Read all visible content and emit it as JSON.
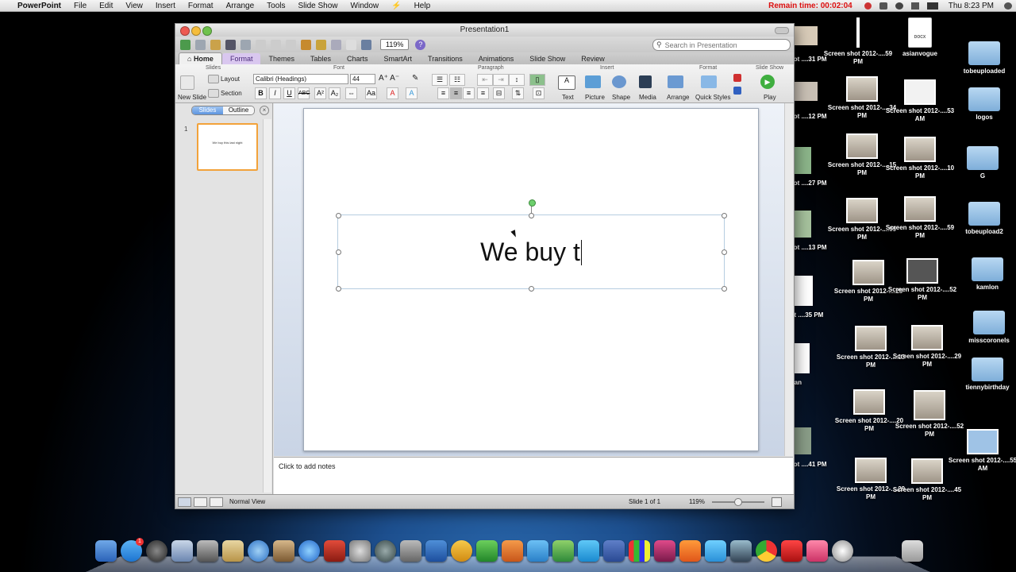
{
  "menubar": {
    "app_name": "PowerPoint",
    "items": [
      "File",
      "Edit",
      "View",
      "Insert",
      "Format",
      "Arrange",
      "Tools",
      "Slide Show",
      "Window",
      "Help"
    ],
    "remain_time": "Remain time: 00:02:04",
    "clock": "Thu 8:23 PM"
  },
  "window": {
    "title": "Presentation1",
    "zoom": "119%",
    "search_placeholder": "Search in Presentation"
  },
  "ribbon_tabs": [
    "Home",
    "Format",
    "Themes",
    "Tables",
    "Charts",
    "SmartArt",
    "Transitions",
    "Animations",
    "Slide Show",
    "Review"
  ],
  "ribbon": {
    "groups": {
      "slides": "Slides",
      "font": "Font",
      "paragraph": "Paragraph",
      "insert": "Insert",
      "format": "Format",
      "slideshow": "Slide Show"
    },
    "new_slide": "New Slide",
    "layout": "Layout",
    "section": "Section",
    "font_name": "Calibri (Headings)",
    "font_size": "44",
    "insert_buttons": [
      "Text",
      "Picture",
      "Shape",
      "Media"
    ],
    "format_buttons": [
      "Arrange",
      "Quick Styles"
    ],
    "play": "Play"
  },
  "left_pane": {
    "tabs": [
      "Slides",
      "Outline"
    ],
    "slide_number": "1",
    "thumb_text": "We buy this last night"
  },
  "slide": {
    "text": "We buy t"
  },
  "notes": {
    "placeholder": "Click to add notes"
  },
  "status": {
    "view": "Normal View",
    "slide": "Slide 1 of 1",
    "zoom": "119%"
  },
  "desktop_icons": {
    "col1": [
      "Screen shot 2012-....59 PM",
      "Screen shot 2012-....34 PM",
      "Screen shot 2012-....15 PM",
      "Screen shot 2012-....09 PM",
      "Screen shot 2012-....25 PM",
      "Screen shot 2012-....13 PM",
      "Screen shot 2012-....20 PM",
      "Screen shot 2012-....29 PM"
    ],
    "col2": [
      "asianvogue",
      "Screen shot 2012-....53 AM",
      "Screen shot 2012-....10 PM",
      "Screen shot 2012-....59 PM",
      "Screen shot 2012-....52 PM",
      "Screen shot 2012-....29 PM",
      "Screen shot 2012-....52 PM",
      "Screen shot 2012-....45 PM"
    ],
    "col3": [
      "tobeuploaded",
      "logos",
      "G",
      "tobeupload2",
      "kamlon",
      "misscoronels",
      "tiennybirthday",
      "Screen shot 2012-....55 AM"
    ],
    "partial": [
      "een shot ....31 PM",
      "een shot ....12 PM",
      "een shot ....27 PM",
      "een shot ....13 PM",
      "en shot ....35 PM",
      "sian",
      "een shot ....41 PM"
    ],
    "doc_label": "DOCX"
  }
}
